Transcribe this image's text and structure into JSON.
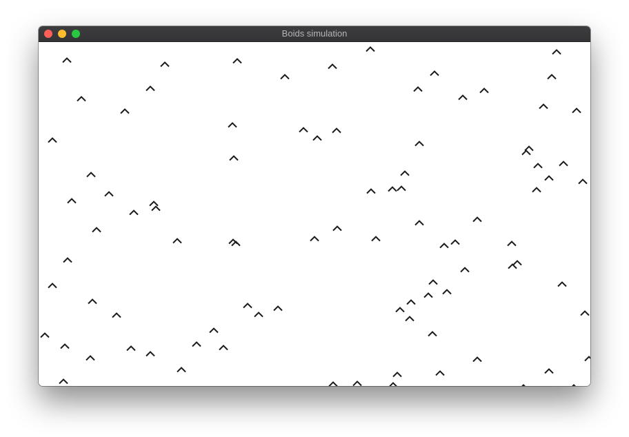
{
  "window": {
    "title": "Boids simulation",
    "controls": {
      "close_color": "#fe5f57",
      "minimize_color": "#febc2e",
      "zoom_color": "#28c840"
    }
  },
  "simulation": {
    "boid_color": "#1a1a1a",
    "background_color": "#ffffff",
    "boid_icon": "chevron-up-icon"
  }
}
